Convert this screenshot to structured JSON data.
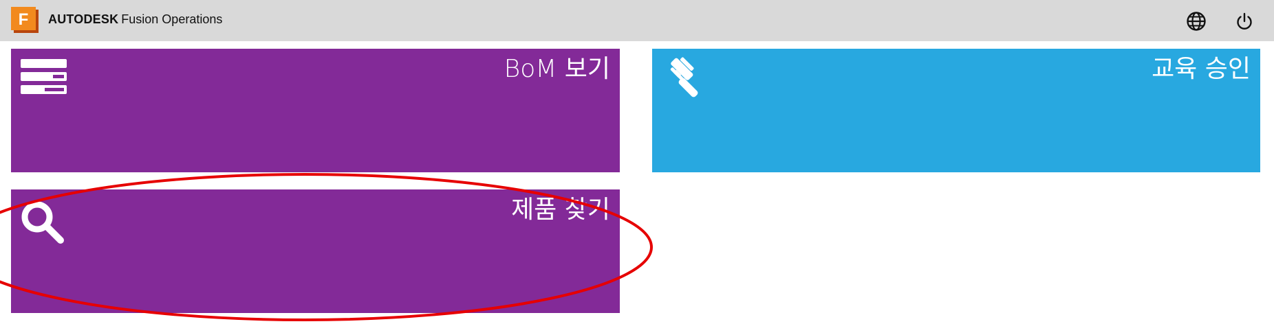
{
  "header": {
    "brand_bold": "AUTODESK",
    "brand_product": "Fusion Operations",
    "logo_letter": "F",
    "language_icon": "globe-icon",
    "logout_icon": "power-icon"
  },
  "tiles": [
    {
      "label": "BoM 보기",
      "icon": "stack-list-icon",
      "color": "#832a98"
    },
    {
      "label": "교육 승인",
      "icon": "gavel-icon",
      "color": "#28a8e0"
    },
    {
      "label": "제품 찾기",
      "icon": "search-icon",
      "color": "#832a98"
    }
  ],
  "annotation": {
    "shape": "ellipse",
    "color": "#e60000",
    "target": "제품 찾기"
  }
}
